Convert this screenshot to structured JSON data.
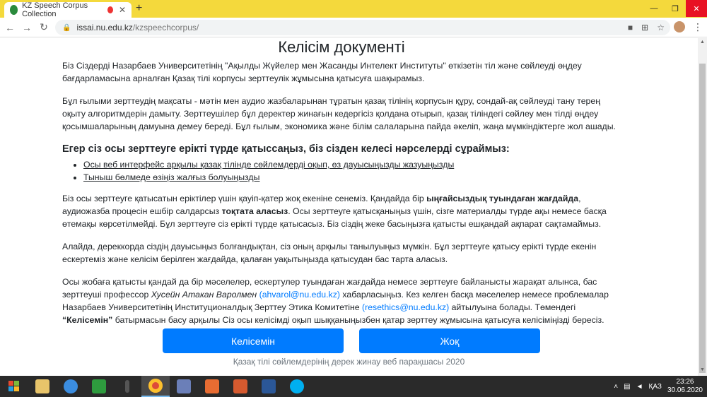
{
  "browser": {
    "tab_title": "KZ Speech Corpus Collection",
    "tab_close": "✕",
    "new_tab": "+",
    "url_host": "issai.nu.edu.kz",
    "url_path": "/kzspeechcorpus/",
    "window_controls": [
      "—",
      "❐",
      "✕"
    ]
  },
  "page": {
    "title": "Келісім документі",
    "para1": "Біз Сіздерді Назарбаев Университетінің \"Ақылды Жүйелер мен Жасанды Интелект Институты\" өткізетін тіл және сөйлеуді өңдеу бағдарламасына арналған Қазақ тілі корпусы зерттеулік жұмысына қатысуға шақырамыз.",
    "para2": "Бұл ғылыми зерттеудің мақсаты - мәтін мен аудио жазбаларынан тұратын қазақ тілінің корпусын құру, сондай-ақ сөйлеуді тану терең оқыту алгоритмдерін дамыту. Зерттеушілер бұл деректер жинағын кедергісіз қолдана отырып, қазақ тіліндегі сөйлеу мен тілді өңдеу қосымшаларының дамуына демеу береді. Бұл ғылым, экономика және білім салаларына пайда әкеліп, жаңа мүмкіндіктерге жол ашады.",
    "heading": "Егер сіз осы зерттеуге ерікті түрде қатыссаңыз, біз сізден келесі нәрселерді сұраймыз:",
    "list": [
      "Осы веб интерфейс арқылы қазақ тілінде сөйлемдерді оқып, өз дауысыңызды жазуыңызды",
      "Тыныш бөлмеде өзіңіз жалғыз болуыңызды"
    ],
    "para3_a": "Біз осы зерттеуге қатысатын еріктілер үшін қауіп-қатер жоқ екеніне сенеміз. Қандайда бір ",
    "para3_b": "ыңғайсыздық туындаған жағдайда",
    "para3_c": ", аудиожазба процесін ешбір салдарсыз ",
    "para3_d": "тоқтата аласыз",
    "para3_e": ". Осы зерттеуге қатысқаныңыз үшін, сізге материалды түрде ақы немесе басқа өтемақы көрсетілмейді. Бұл зерттеуге сіз ерікті түрде қатысасыз. Біз сіздің жеке басыңызға қатысты ешқандай ақпарат сақтамаймыз.",
    "para4": "Алайда, дереккорда сіздің дауысыңыз болғандықтан, сіз оның арқылы танылуыңыз мүмкін. Бұл зерттеуге қатысу ерікті түрде екенін ескертеміз және келісім берілген жағдайда, қалаған уақытыңызда қатысудан бас тарта аласыз.",
    "para5_a": "Осы жобаға қатысты қандай да бір мәселелер, ескертулер туындаған жағдайда немесе зерттеуге байланысты жарақат алынса, бас зерттеуші профессор ",
    "para5_name": "Хусейн Атакан Варолмен",
    "para5_email1": "(ahvarol@nu.edu.kz)",
    "para5_b": " хабарласыңыз. Кез келген басқа мәселелер немесе проблемалар Назарбаев Университетінің Институционалдық Зерттеу Этика Комитетіне ",
    "para5_email2": "(resethics@nu.edu.kz)",
    "para5_c": " айтылуына болады. Төмендегі ",
    "para5_btn": "“Келісемін”",
    "para5_d": " батырмасын басу арқылы Сіз осы келісімді оқып шыққаныңызбен қатар зерттеу жұмысына қатысуға келісіміңізді бересіз.",
    "agree_button": "Келісемін",
    "no_button": "Жоқ",
    "footer": "Қазақ тілі сөйлемдерінің дерек жинау веб парақшасы 2020"
  },
  "taskbar": {
    "lang": "ҚАЗ",
    "time": "23:26",
    "date": "30.06.2020"
  }
}
